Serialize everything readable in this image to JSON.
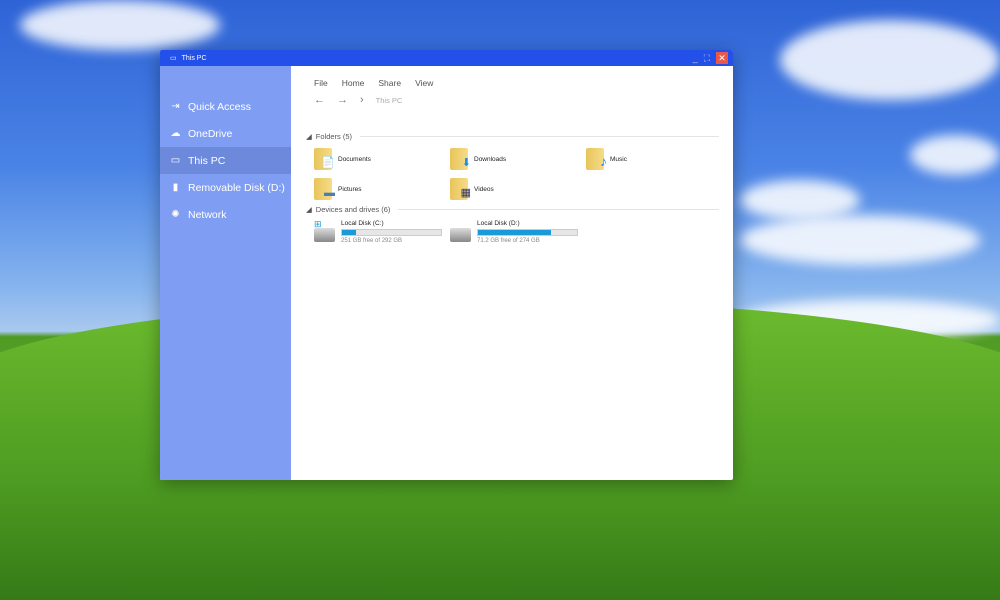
{
  "window": {
    "title": "This PC",
    "minimize": "_",
    "maximize": "⛶",
    "close": "✕"
  },
  "sidebar": {
    "items": [
      {
        "label": "Quick Access",
        "icon": "⇥"
      },
      {
        "label": "OneDrive",
        "icon": "☁"
      },
      {
        "label": "This PC",
        "icon": "▭"
      },
      {
        "label": "Removable Disk (D:)",
        "icon": "▮"
      },
      {
        "label": "Network",
        "icon": "✺"
      }
    ]
  },
  "menu": [
    "File",
    "Home",
    "Share",
    "View"
  ],
  "nav": {
    "back": "←",
    "forward": "→",
    "sep": "›",
    "crumb": "This PC"
  },
  "folders": {
    "header": "Folders (5)",
    "items": [
      {
        "name": "Documents",
        "badge": "📄"
      },
      {
        "name": "Downloads",
        "badge": "⬇"
      },
      {
        "name": "Music",
        "badge": "♪"
      },
      {
        "name": "Pictures",
        "badge": "▬"
      },
      {
        "name": "Videos",
        "badge": "▦"
      }
    ]
  },
  "drives": {
    "header": "Devices and drives (6)",
    "items": [
      {
        "name": "Local Disk (C:)",
        "free": "251 GB free of 292 GB",
        "used_percent": 14
      },
      {
        "name": "Local Disk (D:)",
        "free": "71.2 GB free of 274 GB",
        "used_percent": 74
      }
    ]
  },
  "colors": {
    "accent": "#1c9ad8",
    "titlebar": "#2450ea",
    "sidebar": "#7f9ef3"
  }
}
